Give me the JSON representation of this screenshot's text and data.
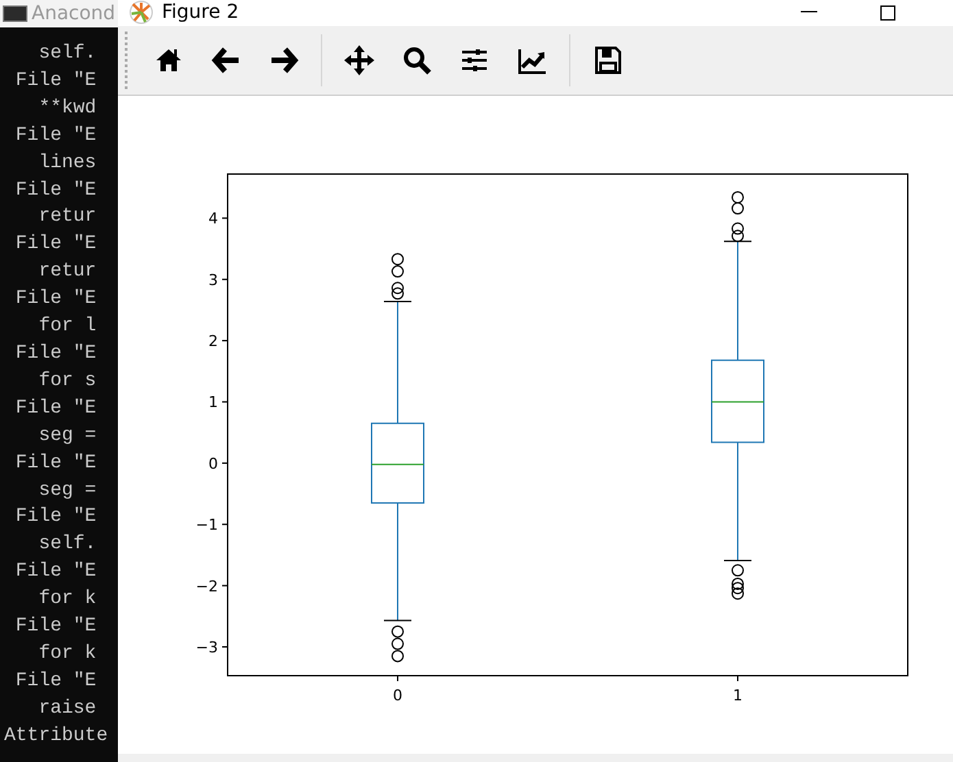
{
  "console": {
    "title": "Anacond",
    "lines": [
      "   self.",
      " File \"E",
      "   **kwd",
      " File \"E",
      "   lines",
      " File \"E",
      "   retur",
      " File \"E",
      "   retur",
      " File \"E",
      "   for l",
      " File \"E",
      "   for s",
      " File \"E",
      "   seg =",
      " File \"E",
      "   seg =",
      " File \"E",
      "   self.",
      " File \"E",
      "   for k",
      " File \"E",
      "   for k",
      " File \"E",
      "   raise",
      "Attribute"
    ]
  },
  "window": {
    "title": "Figure 2"
  },
  "toolbar": [
    {
      "kind": "home"
    },
    {
      "kind": "back"
    },
    {
      "kind": "forward"
    },
    {
      "kind": "sep"
    },
    {
      "kind": "pan"
    },
    {
      "kind": "zoom"
    },
    {
      "kind": "subplots"
    },
    {
      "kind": "lines"
    },
    {
      "kind": "sep"
    },
    {
      "kind": "save"
    }
  ],
  "plot": {
    "y_tick_labels": [
      "4",
      "3",
      "2",
      "1",
      "0",
      "−1",
      "−2",
      "−3"
    ],
    "x_tick_labels": [
      "0",
      "1"
    ]
  }
}
